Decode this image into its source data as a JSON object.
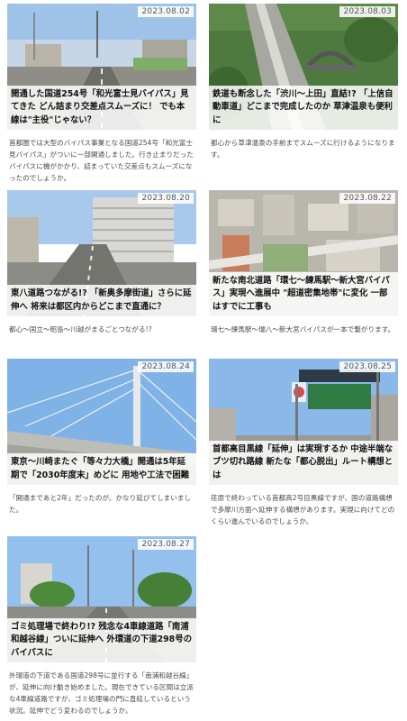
{
  "articles": [
    {
      "date": "2023.08.02",
      "title": "開通した国道254号「和光富士見バイパス」見てきた どん詰まり交差点スムーズに！ でも本線は\"主役\"じゃない？",
      "desc": "首都圏では大型のバイパス事業となる国道254号「和光富士見バイパス」がついに一部開通しました。行き止まりだったバイパスに機がかかり、詰まっていた交差点もスムーズになったのでしょうか。"
    },
    {
      "date": "2023.08.03",
      "title": "鉄道も断念した「渋川～上田」直結!? 「上信自動車道」どこまで完成したのか 草津温泉も便利に",
      "desc": "都心から草津温泉の手前までスムーズに行けるようになります。"
    },
    {
      "date": "2023.08.20",
      "title": "東八道路つながる!? 「新奥多摩街道」さらに延伸へ 将来は都区内からどこまで直通に？",
      "desc": "都心～国立～昭島～川越がまるごとつながる!?"
    },
    {
      "date": "2023.08.22",
      "title": "新たな南北道路「環七～練馬駅～新大宮バイパス」実現へ進展中 \"超道密集地帯\"に変化 一部はすでに工事も",
      "desc": "環七～練馬駅～瑞八～新大宮バイパスが一本で繋がります。"
    },
    {
      "date": "2023.08.24",
      "title": "東京～川崎またぐ「等々力大橋」開通は5年延期で「2030年度末」めどに 用地や工法で困難",
      "desc": "「開通まであと2年」だったのが、かなり延びてしまいました。"
    },
    {
      "date": "2023.08.25",
      "title": "首都高目黒線「延伸」は実現するか 中途半端なブツ切れ路線 新たな「都心脱出」ルート構想とは",
      "desc": "荏原で終わっている首都高2号目黒線ですが、国の道路構想で多摩川方面へ延伸する構想があります。実現に向けてどのくらい進んでいるのでしょうか。"
    },
    {
      "date": "2023.08.27",
      "title": "ゴミ処理場で終わり!? 残念な4車線道路「南浦和越谷線」ついに延伸へ 外環道の下道298号のバイパスに",
      "desc": "外環道の下道である国道298号に並行する「南浦和越谷線」が、延伸に向け動き始めました。現在できている区間は立派な4車線道路ですが、ゴミ処理場の門に直結しているという状況。延伸でどう変わるのでしょうか。"
    }
  ]
}
